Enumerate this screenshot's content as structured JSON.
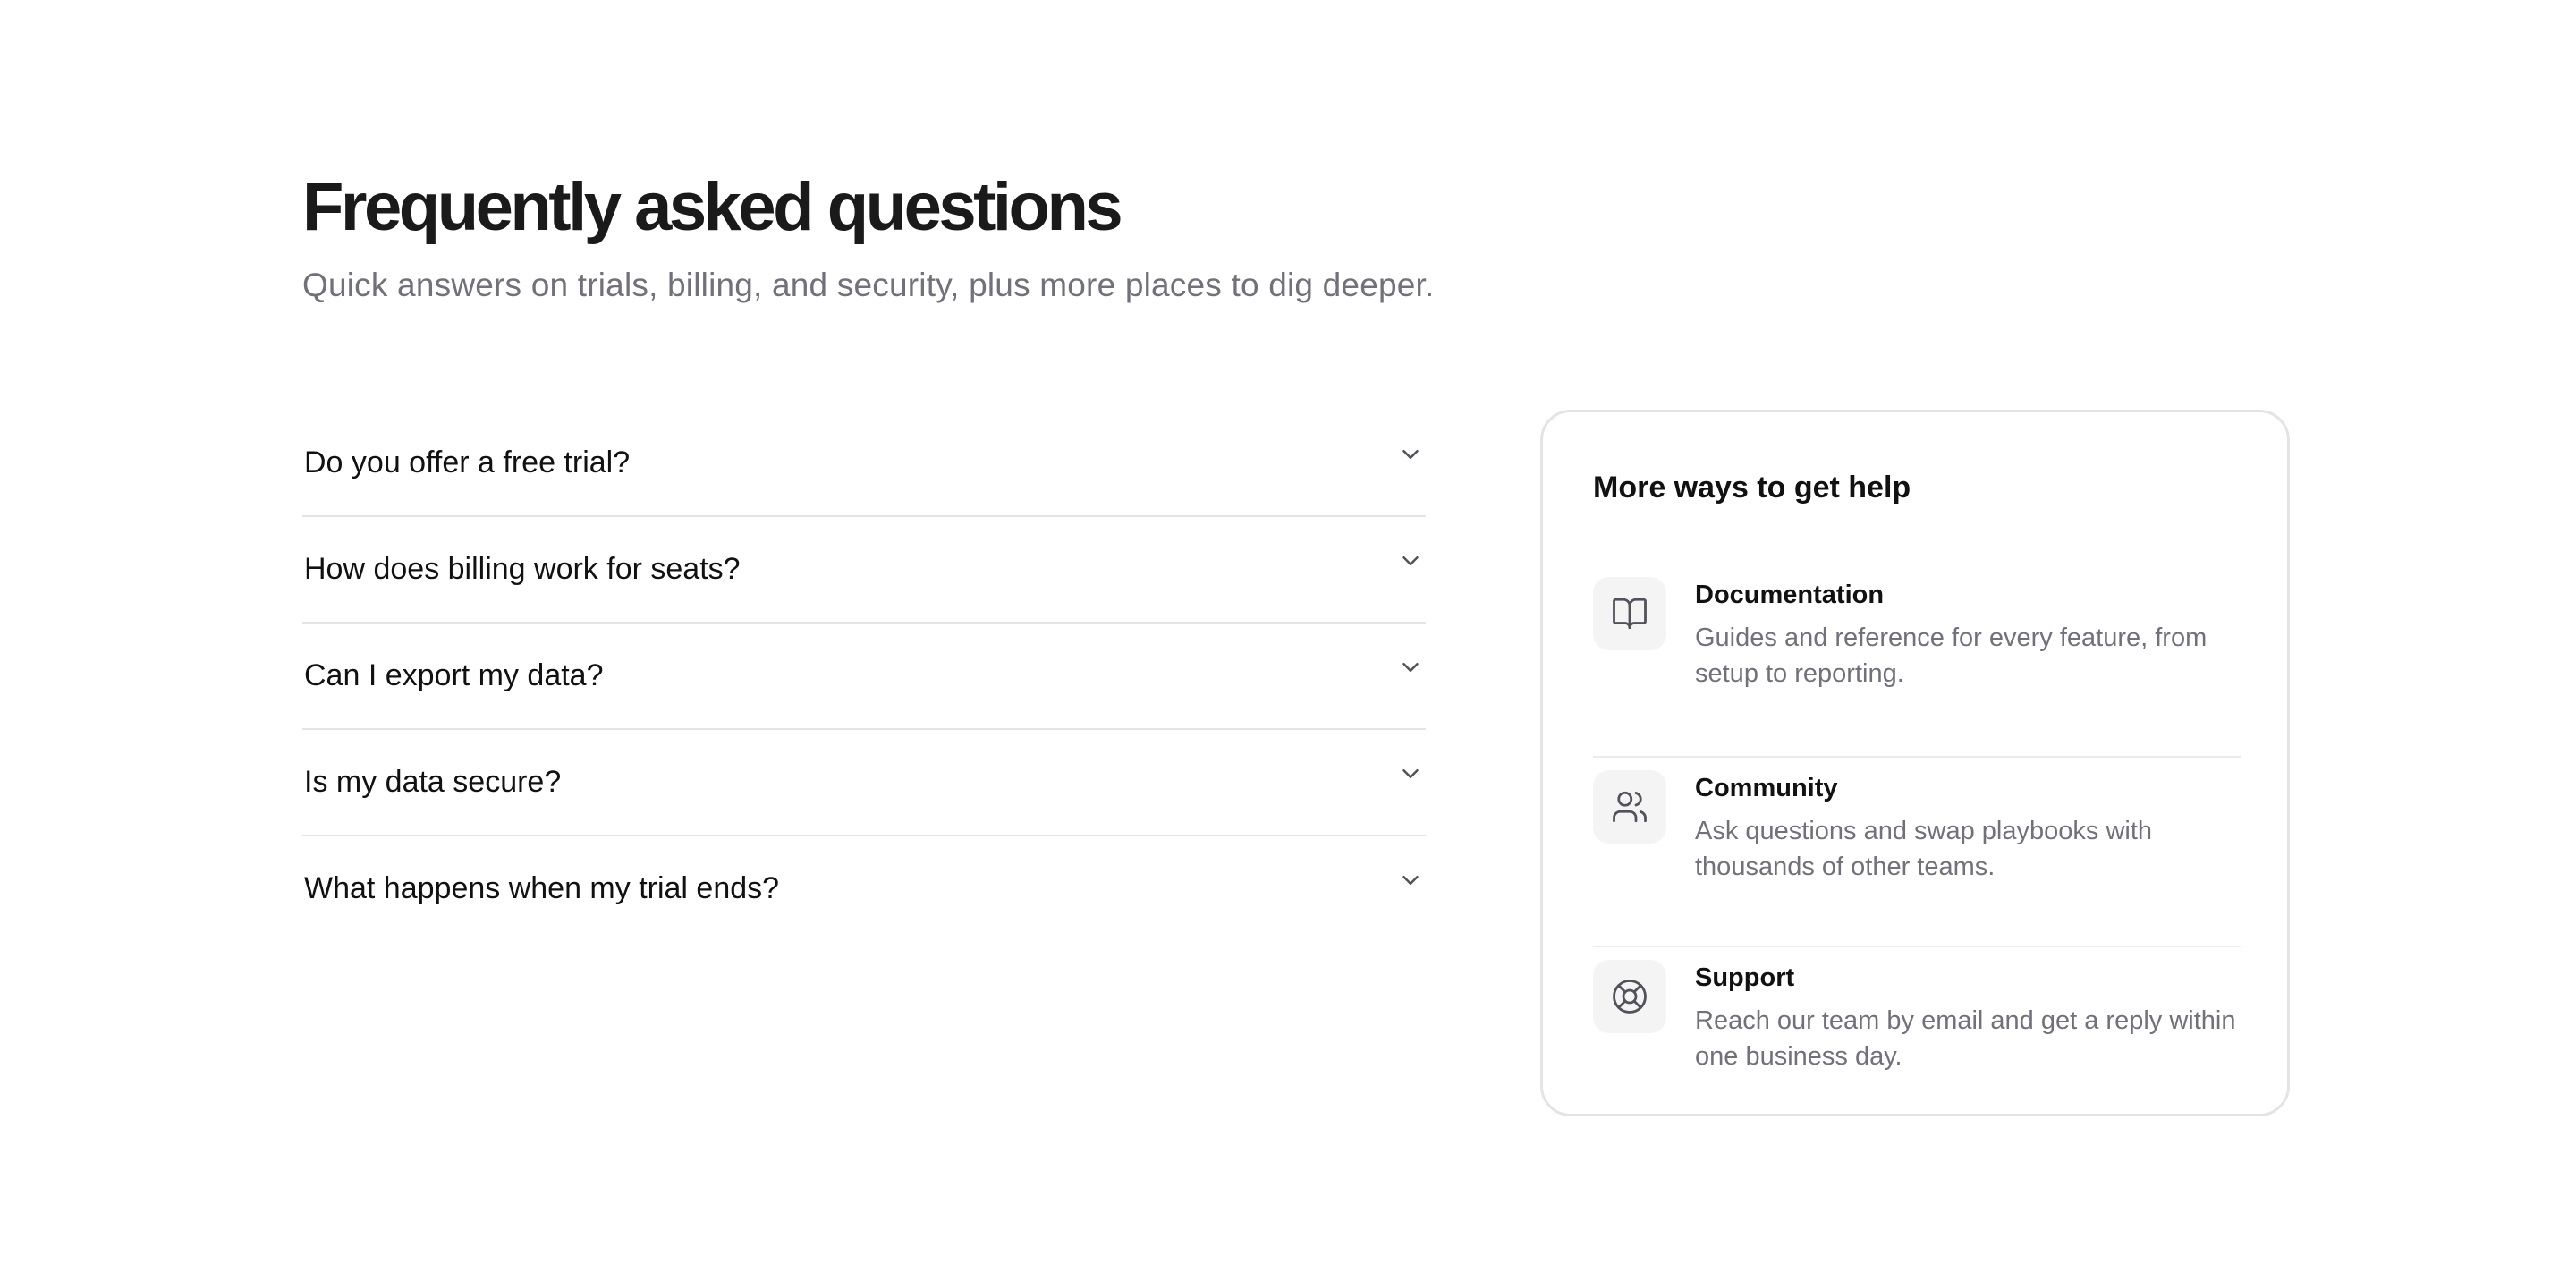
{
  "header": {
    "title": "Frequently asked questions",
    "subtitle": "Quick answers on trials, billing, and security, plus more places to dig deeper."
  },
  "faq": {
    "items": [
      {
        "question": "Do you offer a free trial?",
        "icon": "chevron-down-icon"
      },
      {
        "question": "How does billing work for seats?",
        "icon": "chevron-down-icon"
      },
      {
        "question": "Can I export my data?",
        "icon": "chevron-down-icon"
      },
      {
        "question": "Is my data secure?",
        "icon": "chevron-down-icon"
      },
      {
        "question": "What happens when my trial ends?",
        "icon": "chevron-down-icon"
      }
    ]
  },
  "help": {
    "title": "More ways to get help",
    "items": [
      {
        "title": "Documentation",
        "description": "Guides and reference for every feature, from setup to reporting.",
        "icon": "book-icon"
      },
      {
        "title": "Community",
        "description": "Ask questions and swap playbooks with thousands of other teams.",
        "icon": "users-icon"
      },
      {
        "title": "Support",
        "description": "Reach our team by email and get a reply within one business day.",
        "icon": "life-buoy-icon"
      }
    ]
  },
  "colors": {
    "text": "#111111",
    "muted": "#71717a",
    "border": "#e4e4e7",
    "icon_bg": "#f4f4f5"
  }
}
